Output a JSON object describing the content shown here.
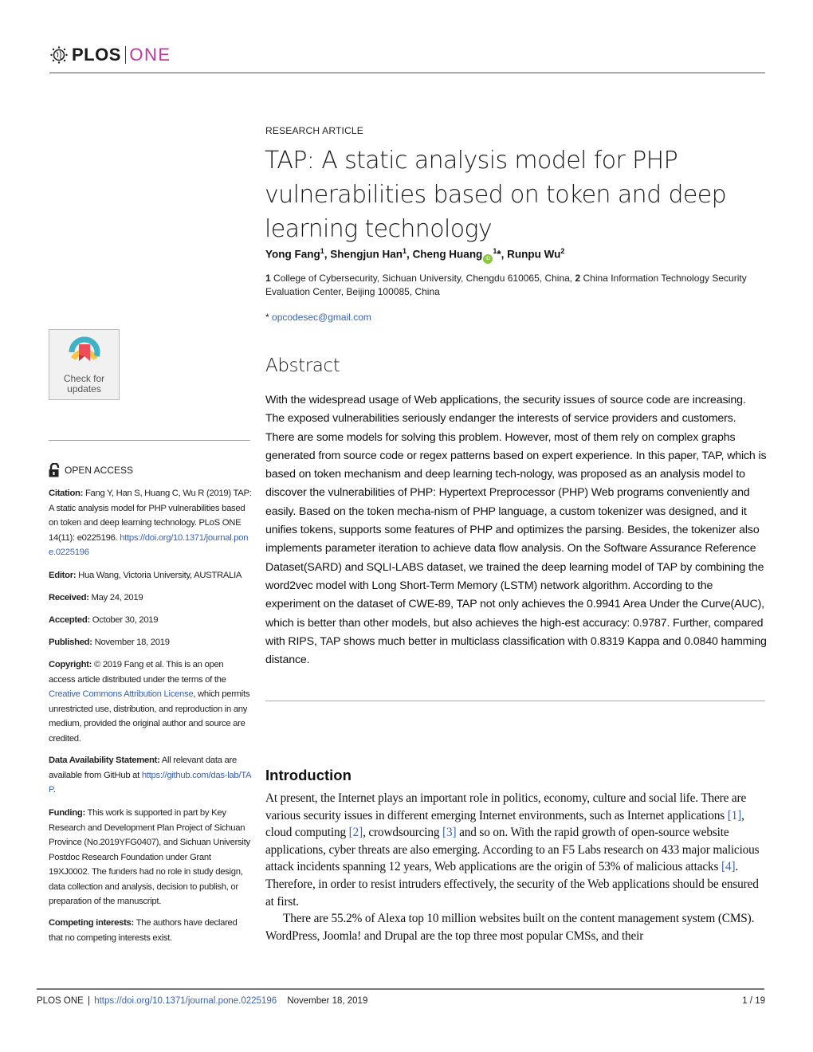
{
  "header": {
    "logo_left": "PLOS",
    "logo_right": "ONE"
  },
  "article": {
    "type": "RESEARCH ARTICLE",
    "title": "TAP: A static analysis model for PHP vulnerabilities based on token and deep learning technology",
    "authors": [
      {
        "name": "Yong Fang",
        "aff": "1",
        "orcid": false,
        "corresponding": false
      },
      {
        "name": "Shengjun Han",
        "aff": "1",
        "orcid": false,
        "corresponding": false
      },
      {
        "name": "Cheng Huang",
        "aff": "1",
        "orcid": true,
        "corresponding": true
      },
      {
        "name": "Runpu Wu",
        "aff": "2",
        "orcid": false,
        "corresponding": false
      }
    ],
    "affiliations": [
      {
        "num": "1",
        "text": "College of Cybersecurity, Sichuan University, Chengdu 610065, China,"
      },
      {
        "num": "2",
        "text": "China Information Technology Security Evaluation Center, Beijing 100085, China"
      }
    ],
    "corresponding_marker": "*",
    "email": "opcodesec@gmail.com"
  },
  "sidebar": {
    "check_updates_line1": "Check for",
    "check_updates_line2": "updates",
    "open_access": "OPEN ACCESS",
    "citation_label": "Citation:",
    "citation_text": "Fang Y, Han S, Huang C, Wu R (2019) TAP: A static analysis model for PHP vulnerabilities based on token and deep learning technology. PLoS ONE 14(11): e0225196.",
    "citation_link": "https://doi.org/10.1371/journal.pone.0225196",
    "editor_label": "Editor:",
    "editor_text": "Hua Wang, Victoria University, AUSTRALIA",
    "received_label": "Received:",
    "received_text": "May 24, 2019",
    "accepted_label": "Accepted:",
    "accepted_text": "October 30, 2019",
    "published_label": "Published:",
    "published_text": "November 18, 2019",
    "copyright_label": "Copyright:",
    "copyright_text_1": "© 2019 Fang et al. This is an open access article distributed under the terms of the",
    "copyright_link": "Creative Commons Attribution License",
    "copyright_text_2": ", which permits unrestricted use, distribution, and reproduction in any medium, provided the original author and source are credited.",
    "data_label": "Data Availability Statement:",
    "data_text": "All relevant data are available from GitHub at",
    "data_link": "https://github.com/das-lab/TAP",
    "data_end": ".",
    "funding_label": "Funding:",
    "funding_text": "This work is supported in part by Key Research and Development Plan Project of Sichuan Province (No.2019YFG0407), and Sichuan University Postdoc Research Foundation under Grant 19XJ0002. The funders had no role in study design, data collection and analysis, decision to publish, or preparation of the manuscript.",
    "competing_label": "Competing interests:",
    "competing_text": "The authors have declared that no competing interests exist."
  },
  "abstract": {
    "heading": "Abstract",
    "text": "With the widespread usage of Web applications, the security issues of source code are increasing. The exposed vulnerabilities seriously endanger the interests of service providers and customers. There are some models for solving this problem. However, most of them rely on complex graphs generated from source code or regex patterns based on expert experience. In this paper, TAP, which is based on token mechanism and deep learning tech-nology, was proposed as an analysis model to discover the vulnerabilities of PHP: Hypertext Preprocessor (PHP) Web programs conveniently and easily. Based on the token mecha-nism of PHP language, a custom tokenizer was designed, and it unifies tokens, supports some features of PHP and optimizes the parsing. Besides, the tokenizer also implements parameter iteration to achieve data flow analysis. On the Software Assurance Reference Dataset(SARD) and SQLI-LABS dataset, we trained the deep learning model of TAP by combining the word2vec model with Long Short-Term Memory (LSTM) network algorithm. According to the experiment on the dataset of CWE-89, TAP not only achieves the 0.9941 Area Under the Curve(AUC), which is better than other models, but also achieves the high-est accuracy: 0.9787. Further, compared with RIPS, TAP shows much better in multiclass classification with 0.8319 Kappa and 0.0840 hamming distance."
  },
  "introduction": {
    "heading": "Introduction",
    "p1_a": "At present, the Internet plays an important role in politics, economy, culture and social life. There are various security issues in different emerging Internet environments, such as Internet applications ",
    "ref1": "[1]",
    "p1_b": ", cloud computing ",
    "ref2": "[2]",
    "p1_c": ", crowdsourcing ",
    "ref3": "[3]",
    "p1_d": " and so on. With the rapid growth of open-source website applications, cyber threats are also emerging. According to an F5 Labs research on 433 major malicious attack incidents spanning 12 years, Web applications are the origin of 53% of malicious attacks ",
    "ref4": "[4]",
    "p1_e": ". Therefore, in order to resist intruders effectively, the security of the Web applications should be ensured at first.",
    "p2": "There are 55.2% of Alexa top 10 million websites built on the content management system (CMS). WordPress, Joomla! and Drupal are the top three most popular CMSs, and their"
  },
  "footer": {
    "journal": "PLOS ONE",
    "separator": "|",
    "doi_link": "https://doi.org/10.1371/journal.pone.0225196",
    "date": "November 18, 2019",
    "page": "1 / 19"
  }
}
